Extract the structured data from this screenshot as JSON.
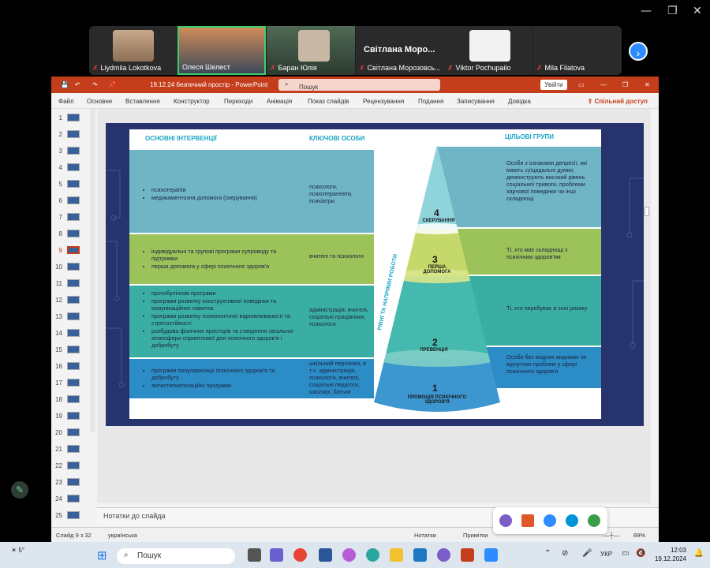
{
  "zoom": {
    "participants": [
      {
        "name": "Liydmila Lokotkova",
        "muted": true
      },
      {
        "name": "Олеся Шелест",
        "muted": false
      },
      {
        "name": "Баран Юлія",
        "muted": true
      },
      {
        "name": "Світлана Морозовсь...",
        "muted": true,
        "caption": "Світлана  Моро..."
      },
      {
        "name": "Viktor Pochupailo",
        "muted": true
      },
      {
        "name": "Mila Filatova",
        "muted": true
      }
    ],
    "next_icon": "chevron-right-icon"
  },
  "ppt": {
    "doc_title": "19.12.24 безпечний простір  -  PowerPoint",
    "search_placeholder": "Пошук",
    "signin": "Увійти",
    "menus": [
      "Файл",
      "Основне",
      "Вставлення",
      "Конструктор",
      "Переходи",
      "Анімація",
      "Показ слайдів",
      "Рецензування",
      "Подання",
      "Записування",
      "Довідка"
    ],
    "share": "Спільний доступ",
    "slide_numbers": [
      "1",
      "2",
      "3",
      "4",
      "5",
      "6",
      "7",
      "8",
      "9",
      "10",
      "11",
      "12",
      "13",
      "14",
      "15",
      "16",
      "17",
      "18",
      "19",
      "20",
      "21",
      "22",
      "23",
      "24",
      "25"
    ],
    "active_slide": "9",
    "notes_placeholder": "Нотатки до слайда",
    "status": {
      "slide": "Слайд 9 з 32",
      "language": "українська",
      "notes": "Нотатки",
      "comments": "Примітки",
      "zoom": "89%"
    }
  },
  "slide": {
    "headers": {
      "interventions": "ОСНОВНІ ІНТЕРВЕНЦІЇ",
      "key_persons": "КЛЮЧОВІ ОСОБИ",
      "target_groups": "ЦІЛЬОВІ ГРУПИ"
    },
    "vertical_label": "РІВНІ ТА НАПРЯМИ РОБОТИ",
    "rows": [
      {
        "interventions": [
          "психотерапія",
          "медикаментозна допомога (скерування)"
        ],
        "persons": "психологи, психотерапевти, психіатри",
        "level_num": "4",
        "level_label": "СКЕРУВАННЯ",
        "target": "Особи з ознаками депресії, які мають суїцидальні думки, демонструють високий рівень соціальної тривоги, проблеми харчової поведінки чи інші складнощі"
      },
      {
        "interventions": [
          "індивідуальні та групові програми супроводу та підтримки",
          "перша допомога у сфері психічного здоров'я"
        ],
        "persons": "вчителі та психологи",
        "level_num": "3",
        "level_label": "ПЕРША ДОПОМОГА",
        "target": "Ті, хто має складнощі з психічним здоров'ям"
      },
      {
        "interventions": [
          "протибулінгові програми",
          "програми розвитку конструктивної поведінки та комунікаційних навичок",
          "програми розвитку психологічної відновлюваності та стресостійкості",
          "розбудова фізичних просторів та створення загальної атмосфери сприятливої для психічного здоров'я і добробуту"
        ],
        "persons": "адміністрація, вчителі, соціальні працівники, психологи",
        "level_num": "2",
        "level_label": "ПРЕВЕНЦІЯ",
        "target": "Ті, хто перебуває в зоні ризику"
      },
      {
        "interventions": [
          "програми популяризації психічного здоров'я та добробуту",
          "антистигматизаційні програми"
        ],
        "persons": "шкільний персонал, в т.ч. адміністрація, психологи, вчителі, соціальні педагоги, школярі, батьки",
        "level_num": "1",
        "level_label": "ПРОМОЦІЯ ПСИХІЧНОГО ЗДОРОВ'Я",
        "target": "Особи без жодних видимих чи відчутних проблем у сфері психічного здоров'я"
      }
    ]
  },
  "taskbar": {
    "weather": "5°",
    "search": "Пошук",
    "lang": "УКР",
    "time": "12:03",
    "date": "19.12.2024"
  },
  "colors": {
    "ppt_accent": "#c43e1c",
    "slide_bg": "#27336d",
    "header_cyan": "#1aa6c9",
    "band1": "#5fb0c0",
    "band2": "#8fbf4a",
    "band3": "#2aa8a0",
    "band4": "#1d7fc0"
  }
}
